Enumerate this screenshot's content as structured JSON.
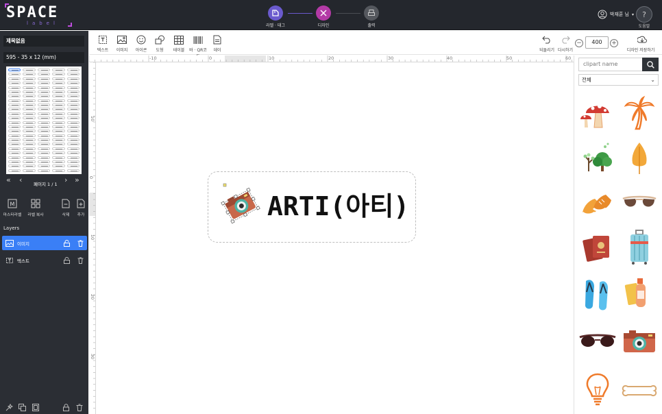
{
  "app": {
    "logo_main": "SPACE",
    "logo_sub": "label",
    "steps": [
      {
        "label": "라벨 · 태그",
        "color": "#6a5acd"
      },
      {
        "label": "디자인",
        "color": "#b33aa6"
      },
      {
        "label": "출력",
        "color": "#55585e"
      }
    ],
    "user_name": "박재훈 님",
    "help_label": "도움말"
  },
  "sidebar": {
    "title_field": "제목없음",
    "size_field": "595 - 35 x 12 (mm)",
    "pager_text": "페이지 1 / 1",
    "tools": [
      {
        "label": "마스터라벨"
      },
      {
        "label": "라벨 복사"
      },
      {
        "label": "삭제"
      },
      {
        "label": "추가"
      }
    ],
    "layers_title": "Layers",
    "layers": [
      {
        "name": "이미지",
        "active": true
      },
      {
        "name": "텍스트",
        "active": false
      }
    ]
  },
  "toolbar": {
    "items": [
      {
        "label": "텍스트"
      },
      {
        "label": "이미지"
      },
      {
        "label": "아이콘"
      },
      {
        "label": "도형"
      },
      {
        "label": "테이블"
      },
      {
        "label": "바 · QR코드"
      },
      {
        "label": "데이"
      }
    ],
    "undo_label": "되돌리기",
    "redo_label": "다시하기",
    "zoom_value": "400",
    "save_label": "디자인 저장하기"
  },
  "ruler": {
    "top_labels": [
      "-10",
      "0",
      "10",
      "20",
      "30",
      "40",
      "50",
      "60"
    ],
    "left_labels": [
      "10",
      "0",
      "10",
      "20",
      "30"
    ]
  },
  "canvas": {
    "label_text": "ARTI(아티)"
  },
  "clipart": {
    "search_placeholder": "clipart name",
    "category": "전체",
    "items": [
      "mushroom-clipart",
      "palm-tree-clipart",
      "trees-clipart",
      "autumn-tree-clipart",
      "sneakers-clipart",
      "sunglasses-clipart",
      "passport-clipart",
      "suitcase-clipart",
      "flip-flops-clipart",
      "sunscreen-clipart",
      "dark-sunglasses-clipart",
      "camera-clipart",
      "lightbulb-clipart",
      "bone-clipart"
    ]
  },
  "colors": {
    "topbar": "#24272d",
    "sidebar": "#2b2e34",
    "active_layer": "#3a7ff6"
  }
}
